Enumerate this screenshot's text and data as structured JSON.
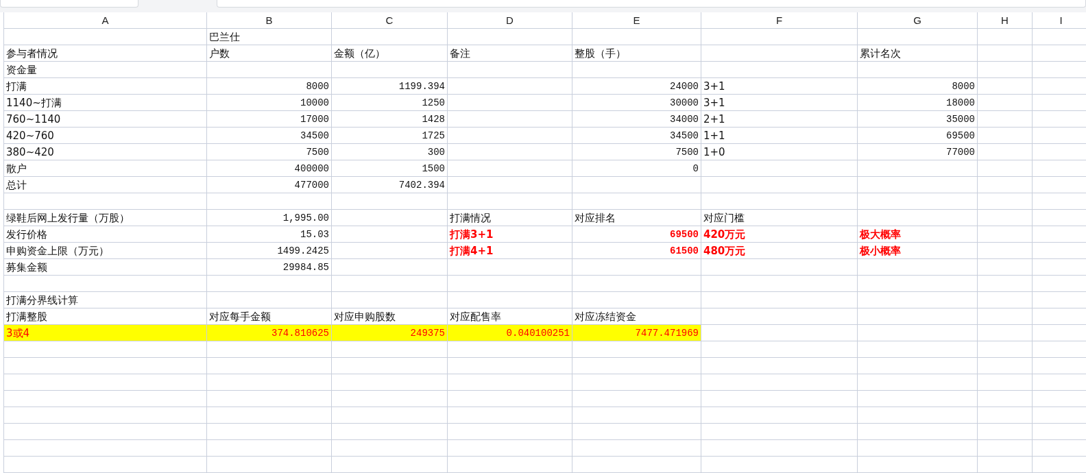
{
  "columns": [
    "A",
    "B",
    "C",
    "D",
    "E",
    "F",
    "G",
    "H",
    "I"
  ],
  "rows": [
    {
      "highlighted": false,
      "cells": [
        null,
        {
          "text": "巴兰仕",
          "kind": "text"
        },
        null,
        null,
        null,
        null,
        null,
        null,
        null
      ]
    },
    {
      "highlighted": false,
      "cells": [
        {
          "text": "参与者情况",
          "kind": "text"
        },
        {
          "text": "户数",
          "kind": "text"
        },
        {
          "text": "金额（亿）",
          "kind": "text"
        },
        {
          "text": "备注",
          "kind": "text"
        },
        {
          "text": "整股（手）",
          "kind": "text"
        },
        null,
        {
          "text": "累计名次",
          "kind": "text"
        },
        null,
        null
      ]
    },
    {
      "highlighted": false,
      "cells": [
        {
          "text": "资金量",
          "kind": "text"
        },
        null,
        null,
        null,
        null,
        null,
        null,
        null,
        null
      ]
    },
    {
      "highlighted": false,
      "cells": [
        {
          "text": "打满",
          "kind": "text"
        },
        {
          "text": "8000",
          "kind": "number"
        },
        {
          "text": "1199.394",
          "kind": "number"
        },
        null,
        {
          "text": "24000",
          "kind": "number"
        },
        {
          "text": "3+1",
          "kind": "text"
        },
        {
          "text": "8000",
          "kind": "number"
        },
        null,
        null
      ]
    },
    {
      "highlighted": false,
      "cells": [
        {
          "text": "1140~打满",
          "kind": "text"
        },
        {
          "text": "10000",
          "kind": "number"
        },
        {
          "text": "1250",
          "kind": "number"
        },
        null,
        {
          "text": "30000",
          "kind": "number"
        },
        {
          "text": "3+1",
          "kind": "text"
        },
        {
          "text": "18000",
          "kind": "number"
        },
        null,
        null
      ]
    },
    {
      "highlighted": false,
      "cells": [
        {
          "text": "760~1140",
          "kind": "text"
        },
        {
          "text": "17000",
          "kind": "number"
        },
        {
          "text": "1428",
          "kind": "number"
        },
        null,
        {
          "text": "34000",
          "kind": "number"
        },
        {
          "text": "2+1",
          "kind": "text"
        },
        {
          "text": "35000",
          "kind": "number"
        },
        null,
        null
      ]
    },
    {
      "highlighted": false,
      "cells": [
        {
          "text": "420~760",
          "kind": "text"
        },
        {
          "text": "34500",
          "kind": "number"
        },
        {
          "text": "1725",
          "kind": "number"
        },
        null,
        {
          "text": "34500",
          "kind": "number"
        },
        {
          "text": "1+1",
          "kind": "text"
        },
        {
          "text": "69500",
          "kind": "number"
        },
        null,
        null
      ]
    },
    {
      "highlighted": false,
      "cells": [
        {
          "text": "380~420",
          "kind": "text"
        },
        {
          "text": "7500",
          "kind": "number"
        },
        {
          "text": "300",
          "kind": "number"
        },
        null,
        {
          "text": "7500",
          "kind": "number"
        },
        {
          "text": "1+0",
          "kind": "text"
        },
        {
          "text": "77000",
          "kind": "number"
        },
        null,
        null
      ]
    },
    {
      "highlighted": false,
      "cells": [
        {
          "text": "散户",
          "kind": "text"
        },
        {
          "text": "400000",
          "kind": "number"
        },
        {
          "text": "1500",
          "kind": "number"
        },
        null,
        {
          "text": "0",
          "kind": "number"
        },
        null,
        null,
        null,
        null
      ]
    },
    {
      "highlighted": false,
      "cells": [
        {
          "text": "总计",
          "kind": "text"
        },
        {
          "text": "477000",
          "kind": "number"
        },
        {
          "text": "7402.394",
          "kind": "number"
        },
        null,
        null,
        null,
        null,
        null,
        null
      ]
    },
    {
      "highlighted": false,
      "cells": [
        null,
        null,
        null,
        null,
        null,
        null,
        null,
        null,
        null
      ]
    },
    {
      "highlighted": false,
      "cells": [
        {
          "text": "绿鞋后网上发行量（万股）",
          "kind": "text"
        },
        {
          "text": "1,995.00",
          "kind": "number"
        },
        null,
        {
          "text": "打满情况",
          "kind": "text"
        },
        {
          "text": "对应排名",
          "kind": "text"
        },
        {
          "text": "对应门槛",
          "kind": "text"
        },
        null,
        null,
        null
      ]
    },
    {
      "highlighted": false,
      "cells": [
        {
          "text": "发行价格",
          "kind": "text"
        },
        {
          "text": "15.03",
          "kind": "number"
        },
        null,
        {
          "text": "打满3+1",
          "kind": "alert_text"
        },
        {
          "text": "69500",
          "kind": "alert_number"
        },
        {
          "text": "420万元",
          "kind": "alert_text"
        },
        {
          "text": "极大概率",
          "kind": "alert_text"
        },
        null,
        null
      ]
    },
    {
      "highlighted": false,
      "cells": [
        {
          "text": "申购资金上限（万元）",
          "kind": "text"
        },
        {
          "text": "1499.2425",
          "kind": "number"
        },
        null,
        {
          "text": "打满4+1",
          "kind": "alert_text"
        },
        {
          "text": "61500",
          "kind": "alert_number"
        },
        {
          "text": "480万元",
          "kind": "alert_text"
        },
        {
          "text": "极小概率",
          "kind": "alert_text"
        },
        null,
        null
      ]
    },
    {
      "highlighted": false,
      "cells": [
        {
          "text": "募集金额",
          "kind": "text"
        },
        {
          "text": "29984.85",
          "kind": "number"
        },
        null,
        null,
        null,
        null,
        null,
        null,
        null
      ]
    },
    {
      "highlighted": false,
      "cells": [
        null,
        null,
        null,
        null,
        null,
        null,
        null,
        null,
        null
      ]
    },
    {
      "highlighted": false,
      "cells": [
        {
          "text": "打满分界线计算",
          "kind": "text"
        },
        null,
        null,
        null,
        null,
        null,
        null,
        null,
        null
      ]
    },
    {
      "highlighted": false,
      "cells": [
        {
          "text": "打满整股",
          "kind": "text"
        },
        {
          "text": "对应每手金额",
          "kind": "text"
        },
        {
          "text": "对应申购股数",
          "kind": "text"
        },
        {
          "text": "对应配售率",
          "kind": "text"
        },
        {
          "text": "对应冻结资金",
          "kind": "text"
        },
        null,
        null,
        null,
        null
      ]
    },
    {
      "highlighted": true,
      "cells": [
        {
          "text": "3或4",
          "kind": "text"
        },
        {
          "text": "374.810625",
          "kind": "number"
        },
        {
          "text": "249375",
          "kind": "number"
        },
        {
          "text": "0.040100251",
          "kind": "number"
        },
        {
          "text": "7477.471969",
          "kind": "number"
        },
        null,
        null,
        null,
        null
      ]
    }
  ]
}
